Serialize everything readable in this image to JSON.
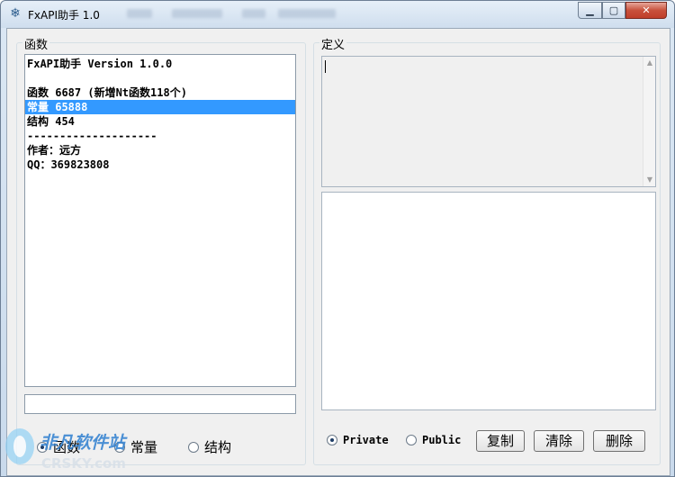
{
  "window": {
    "title": "FxAPI助手 1.0",
    "icon": "snowflake-icon",
    "minimize_icon": "minimize-icon",
    "maximize_icon": "maximize-icon",
    "close_icon": "close-icon"
  },
  "functions_panel": {
    "label": "函数",
    "list_items": [
      "FxAPI助手 Version 1.0.0",
      "",
      "函数 6687 (新增Nt函数118个)",
      "常量 65888",
      "结构 454",
      "--------------------",
      "作者：远方",
      "QQ：369823808"
    ],
    "selected_index": 3,
    "search_value": "",
    "radios": [
      {
        "label": "函数",
        "checked": true
      },
      {
        "label": "常量",
        "checked": false
      },
      {
        "label": "结构",
        "checked": false
      }
    ]
  },
  "definition_panel": {
    "label": "定义",
    "definition_text": "",
    "output_text": "",
    "radios": [
      {
        "label": "Private",
        "checked": true
      },
      {
        "label": "Public",
        "checked": false
      }
    ],
    "buttons": {
      "copy": "复制",
      "clear": "清除",
      "delete": "删除"
    }
  },
  "watermark": {
    "line1": "非凡软件站",
    "line2": "CRSKY.com"
  },
  "colors": {
    "selection": "#3399ff",
    "window_chrome": "#cfdeee",
    "close_button": "#c8513c",
    "watermark_blue": "#2e7fd0"
  }
}
